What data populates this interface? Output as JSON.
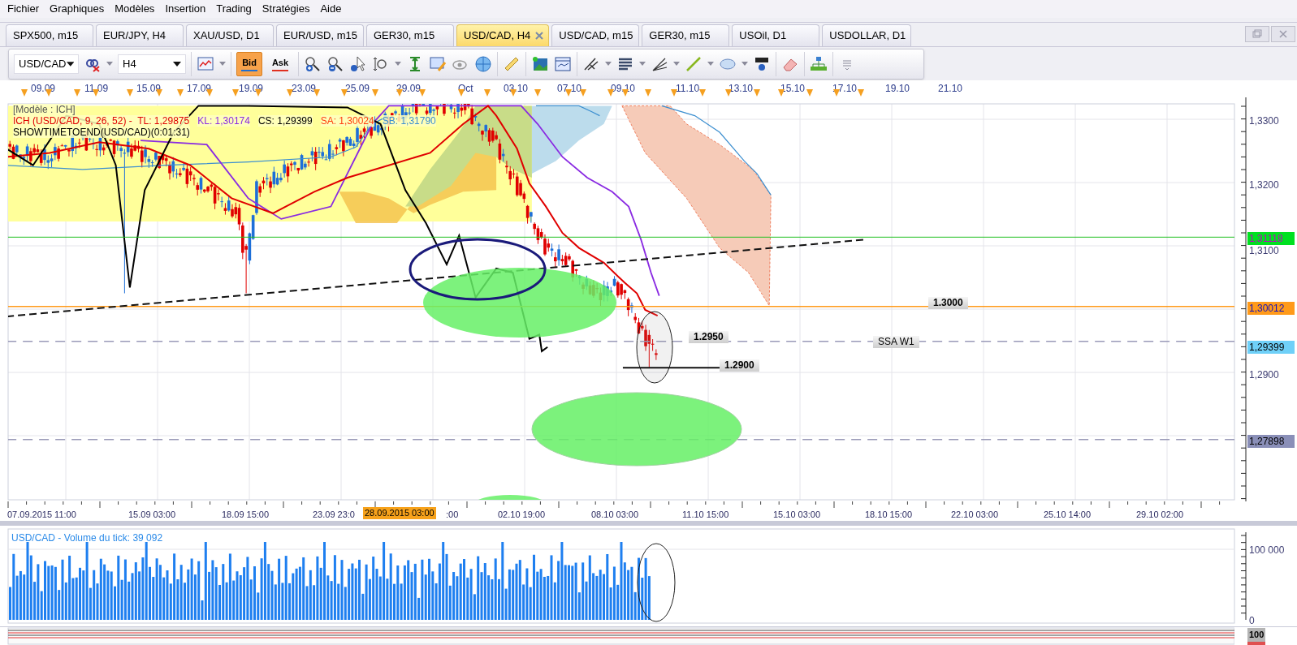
{
  "menu": [
    "Fichier",
    "Graphiques",
    "Modèles",
    "Insertion",
    "Trading",
    "Stratégies",
    "Aide"
  ],
  "tabs": [
    {
      "label": "SPX500, m15",
      "selected": false,
      "closable": false
    },
    {
      "label": "EUR/JPY, H4",
      "selected": false,
      "closable": false
    },
    {
      "label": "XAU/USD, D1",
      "selected": false,
      "closable": false
    },
    {
      "label": "EUR/USD, m15",
      "selected": false,
      "closable": false
    },
    {
      "label": "GER30, m15",
      "selected": false,
      "closable": false
    },
    {
      "label": "USD/CAD, H4",
      "selected": true,
      "closable": true
    },
    {
      "label": "USD/CAD, m15",
      "selected": false,
      "closable": false
    },
    {
      "label": "GER30, m15",
      "selected": false,
      "closable": false
    },
    {
      "label": "USOil, D1",
      "selected": false,
      "closable": false
    },
    {
      "label": "USDOLLAR, D1",
      "selected": false,
      "closable": false
    }
  ],
  "toolbar": {
    "symbol": "USD/CAD",
    "timeframe": "H4",
    "price_modes": [
      {
        "label": "Bid",
        "selected": true,
        "color": "#1f6fd0"
      },
      {
        "label": "Ask",
        "selected": false,
        "color": "#e03020"
      }
    ]
  },
  "date_strip": [
    "09.09",
    "11.09",
    "15.09",
    "17.09",
    "19.09",
    "23.09",
    "25.09",
    "29.09",
    "Oct",
    "03.10",
    "07.10",
    "09.10",
    "11.10",
    "13.10",
    "15.10",
    "17.10",
    "19.10",
    "21.10"
  ],
  "chart": {
    "legend": {
      "model": "[Modèle : ICH]",
      "indicator": [
        {
          "text": "ICH (USD/CAD, 9, 26, 52) -  TL: 1,29875",
          "color": "#e00000"
        },
        {
          "text": "KL: 1,30174",
          "color": "#8a2be2"
        },
        {
          "text": "CS: 1,29399",
          "color": "#000000"
        },
        {
          "text": "SA: 1,30024",
          "color": "#ff4010"
        },
        {
          "text": "SB: 1,31790",
          "color": "#3c8fd0"
        }
      ],
      "timer": "SHOWTIMETOEND(USD/CAD)(0:01:31)"
    },
    "levels": [
      {
        "text": "1.3000",
        "bold": true
      },
      {
        "text": "1.2950",
        "bold": true
      },
      {
        "text": "1.2900",
        "bold": true
      },
      {
        "text": "SSA W1",
        "bold": false
      }
    ],
    "price_axis": [
      "1,3300",
      "1,3200",
      "1,3100",
      "1,2900"
    ],
    "price_tags": [
      {
        "text": "1,31118",
        "color": "#00e020"
      },
      {
        "text": "1,30012",
        "color": "#ff9a1a"
      },
      {
        "text": "1,29399",
        "color": "#6fd0f8"
      },
      {
        "text": "1,27898",
        "color": "#8a8fb8"
      }
    ]
  },
  "time_axis": {
    "labels": [
      "07.09.2015 11:00",
      "15.09 03:00",
      "18.09 15:00",
      "23.09 23:0",
      ":00",
      "02.10 19:00",
      "08.10 03:00",
      "11.10 15:00",
      "15.10 03:00",
      "18.10 15:00",
      "22.10 03:00",
      "25.10 14:00",
      "29.10 02:00"
    ],
    "cursor": "28.09.2015 03:00"
  },
  "volume": {
    "title": "USD/CAD - Volume du tick: 39 092",
    "axis": [
      "100 000",
      "0"
    ]
  },
  "bottom_strip": {
    "axis": "100"
  }
}
